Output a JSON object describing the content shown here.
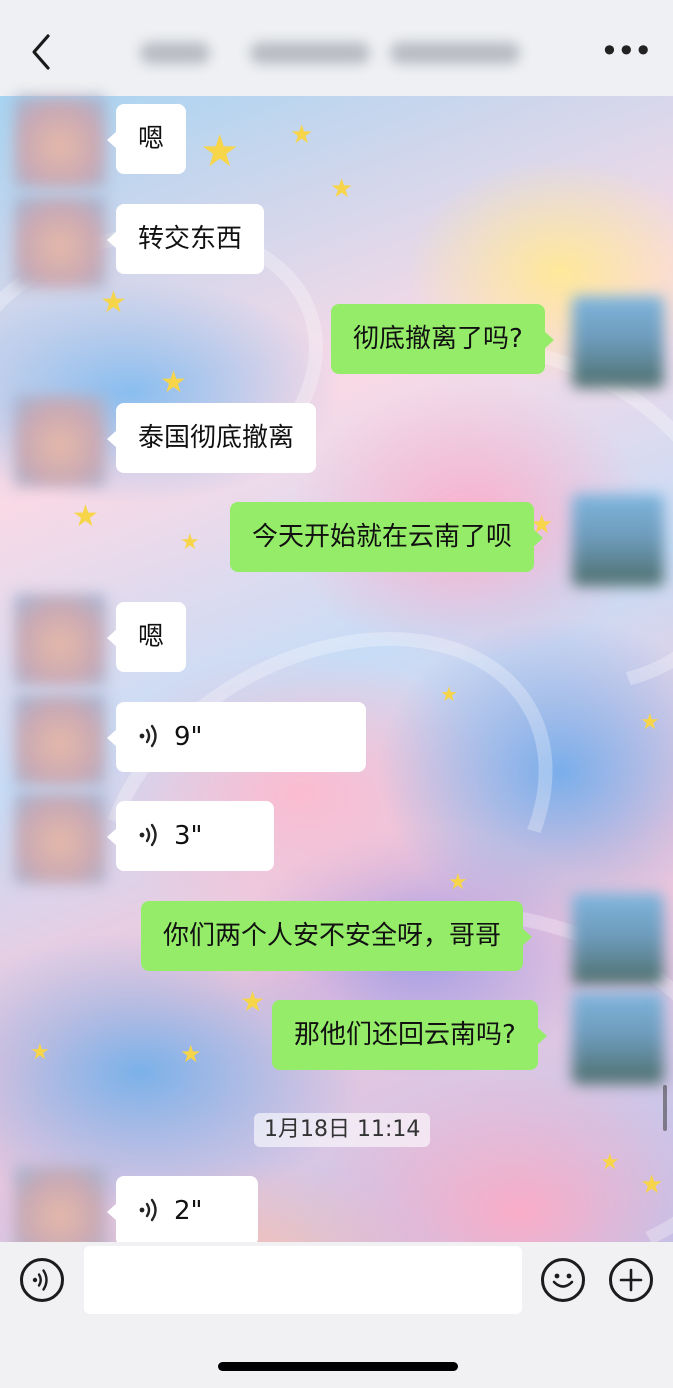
{
  "header": {
    "title": "",
    "back_icon": "chevron-left-icon",
    "more_icon": "more-dots-icon",
    "more_label": "•••"
  },
  "messages": [
    {
      "side": "left",
      "type": "text",
      "text": "嗯"
    },
    {
      "side": "left",
      "type": "text",
      "text": "转交东西"
    },
    {
      "side": "right",
      "type": "text",
      "text": "彻底撤离了吗?"
    },
    {
      "side": "left",
      "type": "text",
      "text": "泰国彻底撤离"
    },
    {
      "side": "right",
      "type": "text",
      "text": "今天开始就在云南了呗"
    },
    {
      "side": "left",
      "type": "text",
      "text": "嗯"
    },
    {
      "side": "left",
      "type": "voice",
      "text": "9\""
    },
    {
      "side": "left",
      "type": "voice",
      "text": "3\""
    },
    {
      "side": "right",
      "type": "text",
      "text": "你们两个人安不安全呀，哥哥"
    },
    {
      "side": "right",
      "type": "text",
      "text": "那他们还回云南吗?"
    },
    {
      "side": "left",
      "type": "voice",
      "text": "2\""
    }
  ],
  "timestamp": "1月18日 11:14",
  "input_bar": {
    "voice_icon": "voice-input-icon",
    "emoji_icon": "emoji-icon",
    "add_icon": "plus-circle-icon",
    "value": "",
    "placeholder": ""
  },
  "colors": {
    "incoming_bubble": "#ffffff",
    "outgoing_bubble": "#95ec69",
    "header_bg": "#eef0f3",
    "input_bar_bg": "#f1f1f3"
  }
}
